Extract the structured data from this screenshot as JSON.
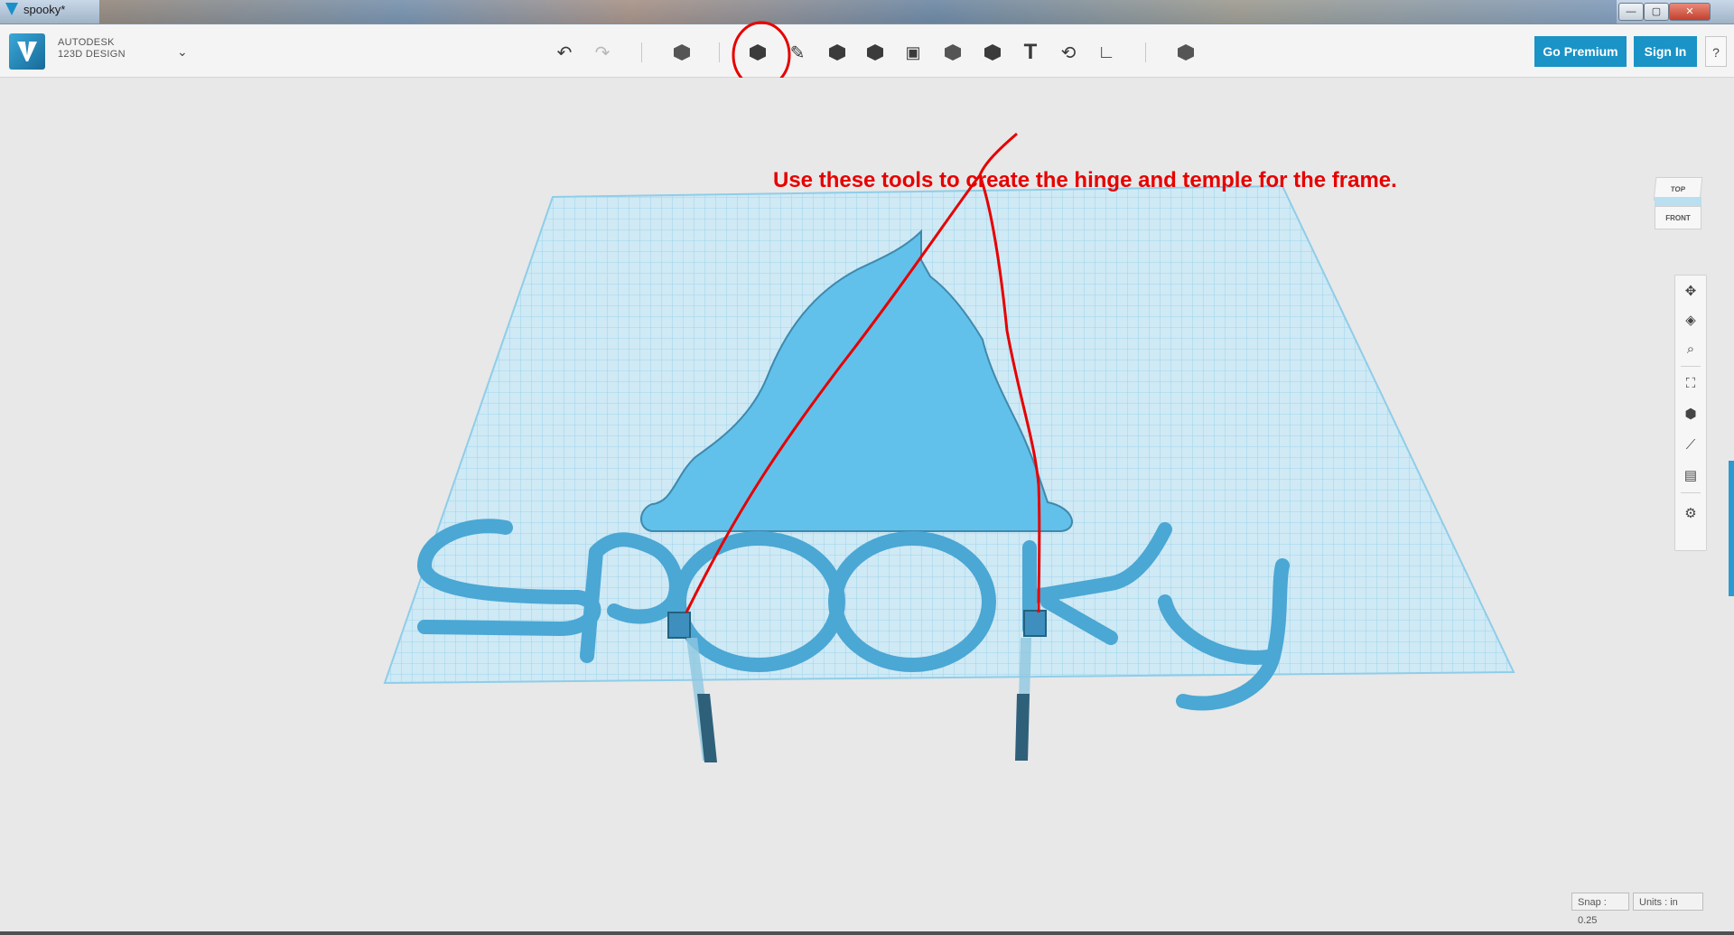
{
  "window": {
    "title": "spooky*",
    "controls": {
      "minimize": "—",
      "maximize": "▢",
      "close": "✕"
    }
  },
  "brand": {
    "line1": "AUTODESK",
    "line2": "123D DESIGN",
    "menu_icon": "chevron-down-icon"
  },
  "toolbar": {
    "tools": [
      "undo-icon",
      "redo-icon",
      "primitives-icon",
      "sketch-icon",
      "construct-icon",
      "modify-icon",
      "pattern-icon",
      "grouping-icon",
      "combine-icon",
      "measure-icon",
      "text-icon",
      "snap-icon",
      "material-icon",
      "view-icon"
    ]
  },
  "buttons": {
    "premium": "Go Premium",
    "signin": "Sign In",
    "help": "?"
  },
  "annotation": {
    "text": "Use these tools to create the hinge and temple for the frame.",
    "color": "#e60000"
  },
  "scene_text": "spooky",
  "viewcube": {
    "top": "TOP",
    "front": "FRONT"
  },
  "navbar": [
    "pan-icon",
    "orbit-icon",
    "zoom-icon",
    "fit-icon",
    "view-mode-icon",
    "visibility-icon",
    "material-view-icon",
    "settings-icon"
  ],
  "status": {
    "snap": "Snap : 0.25",
    "units": "Units : in"
  },
  "colors": {
    "accent": "#1a93c6",
    "model": "#5cbde8",
    "grid": "#bfe3f2"
  }
}
